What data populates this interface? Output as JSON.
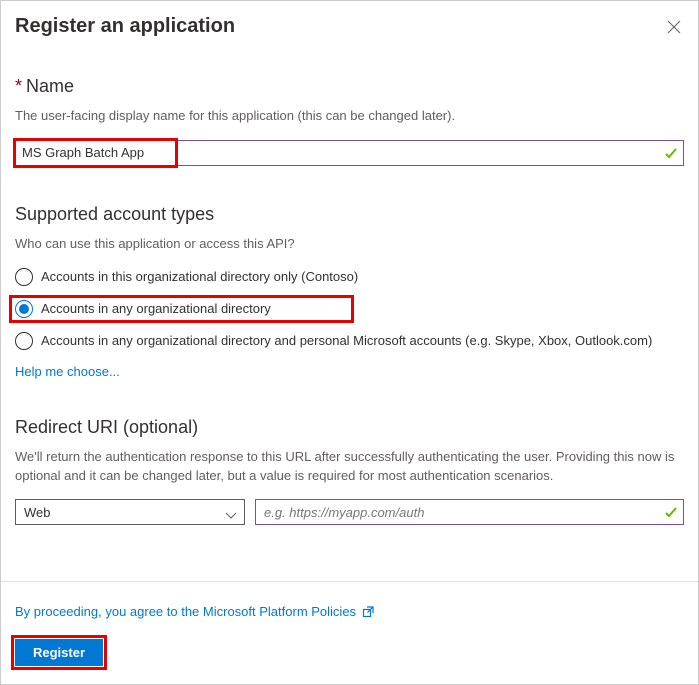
{
  "header": {
    "title": "Register an application"
  },
  "name": {
    "label": "Name",
    "helper": "The user-facing display name for this application (this can be changed later).",
    "value": "MS Graph Batch App"
  },
  "accountTypes": {
    "label": "Supported account types",
    "helper": "Who can use this application or access this API?",
    "options": [
      "Accounts in this organizational directory only (Contoso)",
      "Accounts in any organizational directory",
      "Accounts in any organizational directory and personal Microsoft accounts (e.g. Skype, Xbox, Outlook.com)"
    ],
    "helpLink": "Help me choose..."
  },
  "redirect": {
    "label": "Redirect URI (optional)",
    "helper": "We'll return the authentication response to this URL after successfully authenticating the user. Providing this now is optional and it can be changed later, but a value is required for most authentication scenarios.",
    "platform": "Web",
    "placeholder": "e.g. https://myapp.com/auth"
  },
  "footer": {
    "policyText": "By proceeding, you agree to the Microsoft Platform Policies",
    "registerLabel": "Register"
  }
}
